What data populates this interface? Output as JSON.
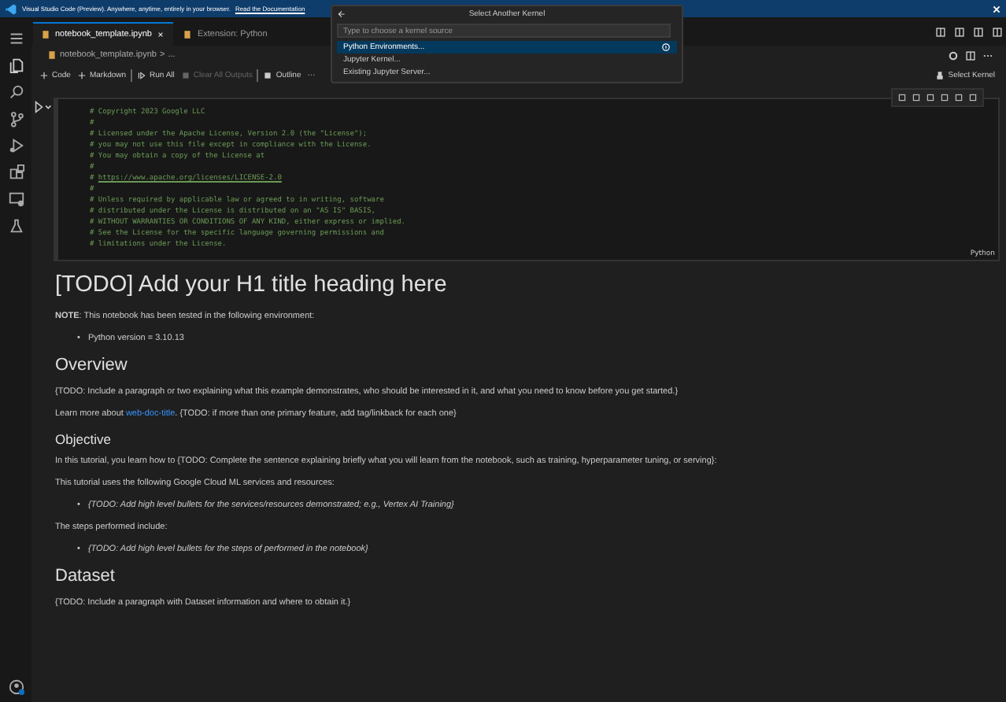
{
  "banner": {
    "text": "Visual Studio Code (Preview). Anywhere, anytime, entirely in your browser.",
    "link": "Read the Documentation"
  },
  "tabs": [
    {
      "label": "notebook_template.ipynb",
      "selected": true
    },
    {
      "label": "Extension: Python",
      "selected": false
    }
  ],
  "breadcrumb": [
    "notebook_template.ipynb",
    ">",
    "..."
  ],
  "toolbar": [
    {
      "label": "Code",
      "kind": "add",
      "disabled": false
    },
    {
      "label": "Markdown",
      "kind": "add",
      "disabled": false
    },
    {
      "label": "Run All",
      "kind": "run",
      "disabled": false
    },
    {
      "label": "Clear All Outputs",
      "kind": "clear",
      "disabled": true
    },
    {
      "label": "Outline",
      "kind": "outline",
      "disabled": false
    },
    {
      "label": "···",
      "kind": "more",
      "disabled": false
    }
  ],
  "kernel": "Select Kernel",
  "quick_pick": {
    "title": "Select Another Kernel",
    "placeholder": "Type to choose a kernel source",
    "items": [
      {
        "label": "Python Environments...",
        "selected": true
      },
      {
        "label": "Jupyter Kernel...",
        "selected": false
      },
      {
        "label": "Existing Jupyter Server...",
        "selected": false
      }
    ]
  },
  "code_cell": {
    "language": "Python",
    "lines": [
      {
        "kind": "comment",
        "text": "# Copyright 2023 Google LLC"
      },
      {
        "kind": "comment",
        "text": "#"
      },
      {
        "kind": "comment",
        "text": "# Licensed under the Apache License, Version 2.0 (the \"License\");"
      },
      {
        "kind": "comment",
        "text": "# you may not use this file except in compliance with the License."
      },
      {
        "kind": "comment",
        "text": "# You may obtain a copy of the License at"
      },
      {
        "kind": "comment",
        "text": "#"
      },
      {
        "kind": "link",
        "text": "#",
        "link": "https://www.apache.org/licenses/LICENSE-2.0"
      },
      {
        "kind": "comment",
        "text": "#"
      },
      {
        "kind": "comment",
        "text": "# Unless required by applicable law or agreed to in writing, software"
      },
      {
        "kind": "comment",
        "text": "# distributed under the License is distributed on an \"AS IS\" BASIS,"
      },
      {
        "kind": "comment",
        "text": "# WITHOUT WARRANTIES OR CONDITIONS OF ANY KIND, either express or implied."
      },
      {
        "kind": "comment",
        "text": "# See the License for the specific language governing permissions and"
      },
      {
        "kind": "comment",
        "text": "# limitations under the License."
      }
    ]
  },
  "markdown": [
    {
      "kind": "h1",
      "text": "[TODO] Add your H1 title heading here"
    },
    {
      "kind": "p",
      "text": "**NOTE**: This notebook has been tested in the following environment:"
    },
    {
      "kind": "ul",
      "marker": "•",
      "items": [
        {
          "text": "Python version = 3.10.13",
          "italic": false
        }
      ]
    },
    {
      "kind": "h2",
      "text": "Overview"
    },
    {
      "kind": "p",
      "text": "{TODO: Include a paragraph or two explaining what this example demonstrates, who should be interested in it, and what you need to know before you get started.}"
    },
    {
      "kind": "plink",
      "before": "Learn more about",
      "link": "web-doc-title",
      "after": ". {TODO: if more than one primary feature, add tag/linkback for each one}"
    },
    {
      "kind": "h3",
      "text": "Objective"
    },
    {
      "kind": "p",
      "text": "In this tutorial, you learn how to {TODO: Complete the sentence explaining briefly what you will learn from the notebook, such as training, hyperparameter tuning, or serving}:"
    },
    {
      "kind": "p",
      "text": "This tutorial uses the following Google Cloud ML services and resources:"
    },
    {
      "kind": "ul",
      "marker": "•",
      "items": [
        {
          "text": "{TODO: Add high level bullets for the services/resources demonstrated; e.g., Vertex AI Training}",
          "italic": true
        }
      ]
    },
    {
      "kind": "p",
      "text": "The steps performed include:"
    },
    {
      "kind": "ul",
      "marker": "•",
      "items": [
        {
          "text": "{TODO: Add high level bullets for the steps of performed in the notebook}",
          "italic": true
        }
      ]
    },
    {
      "kind": "h2",
      "text": "Dataset"
    },
    {
      "kind": "p",
      "text": "{TODO: Include a paragraph with Dataset information and where to obtain it.}"
    }
  ]
}
